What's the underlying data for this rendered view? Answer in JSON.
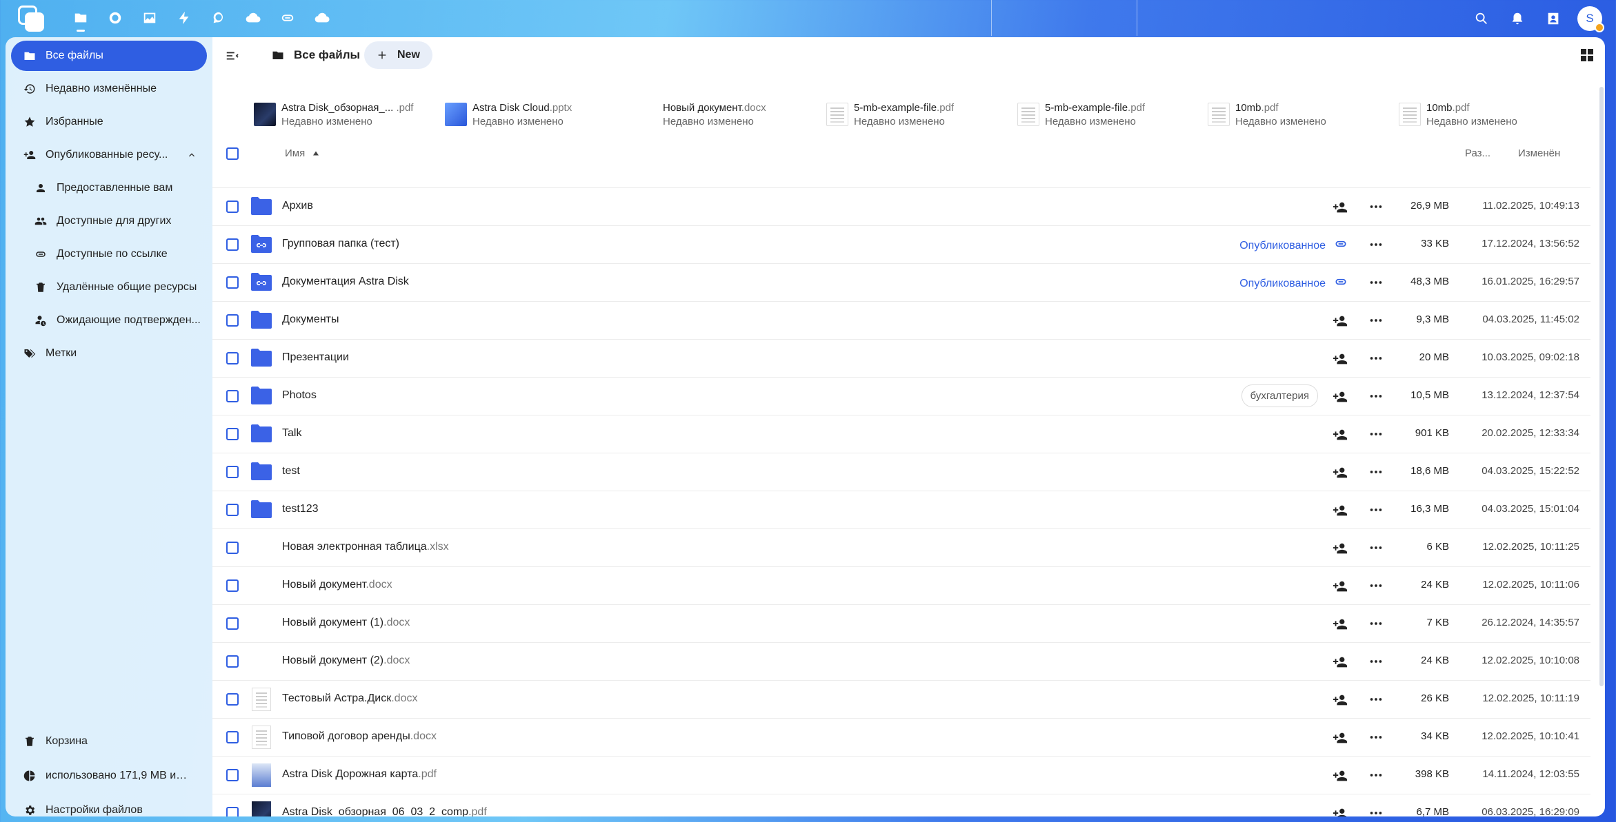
{
  "topbar": {
    "apps": [
      "files",
      "photos-circle",
      "gallery",
      "activity",
      "talk",
      "cloud",
      "link",
      "cloud2"
    ],
    "user_initial": "S"
  },
  "sidebar": {
    "items": [
      {
        "label": "Все файлы",
        "icon": "folder-icon",
        "active": true
      },
      {
        "label": "Недавно изменённые",
        "icon": "history-icon"
      },
      {
        "label": "Избранные",
        "icon": "star-icon"
      },
      {
        "label": "Опубликованные ресу...",
        "icon": "share-icon",
        "expanded": true
      },
      {
        "label": "Предоставленные вам",
        "icon": "user-icon",
        "sub": true
      },
      {
        "label": "Доступные для других",
        "icon": "group-icon",
        "sub": true
      },
      {
        "label": "Доступные по ссылке",
        "icon": "link-icon",
        "sub": true
      },
      {
        "label": "Удалённые общие ресурсы",
        "icon": "trash-icon",
        "sub": true
      },
      {
        "label": "Ожидающие подтвержден...",
        "icon": "pending-icon",
        "sub": true
      },
      {
        "label": "Метки",
        "icon": "tag-icon"
      }
    ],
    "bottom": [
      {
        "label": "Корзина",
        "icon": "trash-icon"
      },
      {
        "label": "использовано 171,9 MB из 1...",
        "icon": "pie-icon"
      },
      {
        "label": "Настройки файлов",
        "icon": "gear-icon"
      }
    ]
  },
  "toolbar": {
    "breadcrumb": "Все файлы",
    "new_label": "New"
  },
  "recent": [
    {
      "name": "Astra Disk_обзорная_...",
      "ext": " .pdf",
      "sub": "Недавно изменено",
      "thumb": "photo"
    },
    {
      "name": "Astra Disk Cloud",
      "ext": ".pptx",
      "sub": "Недавно изменено",
      "thumb": "pptx"
    },
    {
      "name": "Новый документ",
      "ext": ".docx",
      "sub": "Недавно изменено",
      "thumb": "blank"
    },
    {
      "name": "5-mb-example-file",
      "ext": ".pdf",
      "sub": "Недавно изменено",
      "thumb": "doc"
    },
    {
      "name": "5-mb-example-file",
      "ext": ".pdf",
      "sub": "Недавно изменено",
      "thumb": "doc"
    },
    {
      "name": "10mb",
      "ext": ".pdf",
      "sub": "Недавно изменено",
      "thumb": "doc"
    },
    {
      "name": "10mb",
      "ext": ".pdf",
      "sub": "Недавно изменено",
      "thumb": "doc"
    }
  ],
  "table": {
    "col_name": "Имя",
    "col_size": "Раз...",
    "col_modified": "Изменён",
    "rows": [
      {
        "name": "Архив",
        "ext": "",
        "kind": "folder",
        "size": "26,9 MB",
        "date": "11.02.2025, 10:49:13"
      },
      {
        "name": "Групповая папка (тест)",
        "ext": "",
        "kind": "folder-link",
        "shared": "Опубликованное",
        "size": "33 KB",
        "date": "17.12.2024, 13:56:52"
      },
      {
        "name": "Документация Astra Disk",
        "ext": "",
        "kind": "folder-link",
        "shared": "Опубликованное",
        "size": "48,3 MB",
        "date": "16.01.2025, 16:29:57"
      },
      {
        "name": "Документы",
        "ext": "",
        "kind": "folder",
        "size": "9,3 MB",
        "date": "04.03.2025, 11:45:02"
      },
      {
        "name": "Презентации",
        "ext": "",
        "kind": "folder",
        "size": "20 MB",
        "date": "10.03.2025, 09:02:18"
      },
      {
        "name": "Photos",
        "ext": "",
        "kind": "folder",
        "tag": "бухгалтерия",
        "size": "10,5 MB",
        "date": "13.12.2024, 12:37:54"
      },
      {
        "name": "Talk",
        "ext": "",
        "kind": "folder",
        "size": "901 KB",
        "date": "20.02.2025, 12:33:34"
      },
      {
        "name": "test",
        "ext": "",
        "kind": "folder",
        "size": "18,6 MB",
        "date": "04.03.2025, 15:22:52"
      },
      {
        "name": "test123",
        "ext": "",
        "kind": "folder",
        "size": "16,3 MB",
        "date": "04.03.2025, 15:01:04"
      },
      {
        "name": "Новая электронная таблица",
        "ext": ".xlsx",
        "kind": "blank",
        "size": "6 KB",
        "date": "12.02.2025, 10:11:25"
      },
      {
        "name": "Новый документ",
        "ext": ".docx",
        "kind": "blank",
        "size": "24 KB",
        "date": "12.02.2025, 10:11:06"
      },
      {
        "name": "Новый документ (1)",
        "ext": ".docx",
        "kind": "blank",
        "size": "7 KB",
        "date": "26.12.2024, 14:35:57"
      },
      {
        "name": "Новый документ (2)",
        "ext": ".docx",
        "kind": "blank",
        "size": "24 KB",
        "date": "12.02.2025, 10:10:08"
      },
      {
        "name": "Тестовый Астра.Диск",
        "ext": ".docx",
        "kind": "doc",
        "size": "26 KB",
        "date": "12.02.2025, 10:11:19"
      },
      {
        "name": "Типовой договор аренды",
        "ext": ".docx",
        "kind": "doc",
        "size": "34 KB",
        "date": "12.02.2025, 10:10:41"
      },
      {
        "name": "Astra Disk Дорожная карта",
        "ext": ".pdf",
        "kind": "roadmap",
        "size": "398 KB",
        "date": "14.11.2024, 12:03:55"
      },
      {
        "name": "Astra Disk_обзорная_06_03_2_comp",
        "ext": ".pdf",
        "kind": "photo",
        "size": "6,7 MB",
        "date": "06.03.2025, 16:29:09"
      }
    ]
  },
  "colors": {
    "accent": "#2f5ee2",
    "folder": "#3b62e6"
  }
}
